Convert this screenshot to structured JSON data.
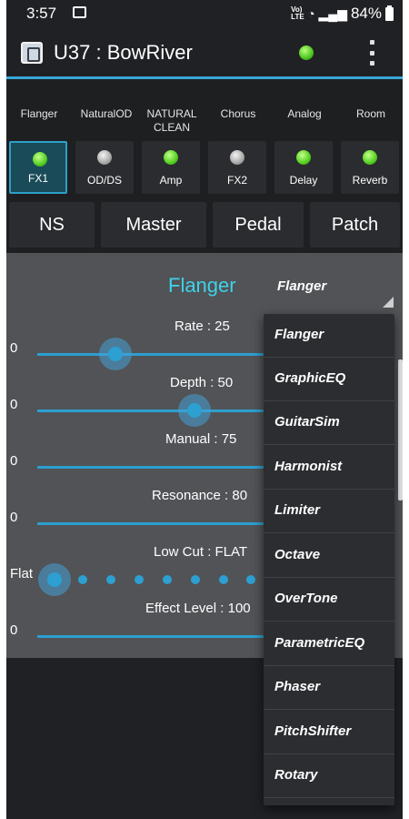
{
  "status_bar": {
    "time": "3:57",
    "battery": "84%",
    "volte_line1": "Vo)",
    "volte_line2": "LTE"
  },
  "app_bar": {
    "title": "U37 : BowRiver",
    "led_color": "#49c41f"
  },
  "effect_labels": [
    {
      "label": "Flanger"
    },
    {
      "label": "NaturalOD"
    },
    {
      "label": "NATURAL\nCLEAN"
    },
    {
      "label": "Chorus"
    },
    {
      "label": "Analog"
    },
    {
      "label": "Room"
    }
  ],
  "fx_buttons": [
    {
      "label": "FX1",
      "led": "on",
      "selected": true
    },
    {
      "label": "OD/DS",
      "led": "off",
      "selected": false
    },
    {
      "label": "Amp",
      "led": "on",
      "selected": false
    },
    {
      "label": "FX2",
      "led": "off",
      "selected": false
    },
    {
      "label": "Delay",
      "led": "on",
      "selected": false
    },
    {
      "label": "Reverb",
      "led": "on",
      "selected": false
    }
  ],
  "big_buttons": [
    {
      "label": "NS"
    },
    {
      "label": "Master"
    },
    {
      "label": "Pedal"
    },
    {
      "label": "Patch"
    }
  ],
  "panel": {
    "title": "Flanger",
    "selected_type": "Flanger",
    "params": [
      {
        "label": "Rate : 25",
        "min": "0",
        "value": 25
      },
      {
        "label": "Depth : 50",
        "min": "0",
        "value": 50
      },
      {
        "label": "Manual : 75",
        "min": "0",
        "value": 75
      },
      {
        "label": "Resonance : 80",
        "min": "0",
        "value": 80
      },
      {
        "label": "Low Cut : FLAT",
        "min": "Flat",
        "value": 0
      },
      {
        "label": "Effect Level : 100",
        "min": "0",
        "value": 100
      }
    ]
  },
  "dropdown": {
    "items": [
      {
        "label": "Flanger"
      },
      {
        "label": "GraphicEQ"
      },
      {
        "label": "GuitarSim"
      },
      {
        "label": "Harmonist"
      },
      {
        "label": "Limiter"
      },
      {
        "label": "Octave"
      },
      {
        "label": "OverTone"
      },
      {
        "label": "ParametricEQ"
      },
      {
        "label": "Phaser"
      },
      {
        "label": "PitchShifter"
      },
      {
        "label": "Rotary"
      }
    ]
  },
  "colors": {
    "accent": "#2d9fd0",
    "title_cyan": "#3fd2ea",
    "led_on": "#54cf21",
    "led_off": "#a8a8a8"
  }
}
